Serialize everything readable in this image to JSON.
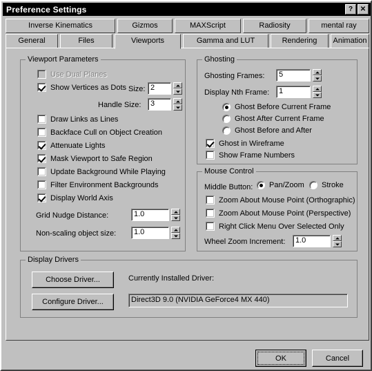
{
  "window": {
    "title": "Preference Settings",
    "help_button": "?",
    "close_button": "✕"
  },
  "tabs": {
    "row1": [
      {
        "label": "Inverse Kinematics",
        "selected": false
      },
      {
        "label": "Gizmos",
        "selected": false
      },
      {
        "label": "MAXScript",
        "selected": false
      },
      {
        "label": "Radiosity",
        "selected": false
      },
      {
        "label": "mental ray",
        "selected": false
      }
    ],
    "row2": [
      {
        "label": "General",
        "selected": false
      },
      {
        "label": "Files",
        "selected": false
      },
      {
        "label": "Viewports",
        "selected": true
      },
      {
        "label": "Gamma and LUT",
        "selected": false
      },
      {
        "label": "Rendering",
        "selected": false
      },
      {
        "label": "Animation",
        "selected": false
      }
    ]
  },
  "viewport_parameters": {
    "title": "Viewport Parameters",
    "use_dual_planes": {
      "label": "Use Dual Planes",
      "checked": false,
      "disabled": true
    },
    "show_vertices_as_dots": {
      "label": "Show Vertices as Dots",
      "checked": true
    },
    "size": {
      "label": "Size:",
      "value": "2"
    },
    "handle_size": {
      "label": "Handle Size:",
      "value": "3"
    },
    "draw_links_as_lines": {
      "label": "Draw Links as Lines",
      "checked": false
    },
    "backface_cull": {
      "label": "Backface Cull on Object Creation",
      "checked": false
    },
    "attenuate_lights": {
      "label": "Attenuate Lights",
      "checked": true
    },
    "mask_viewport_safe_region": {
      "label": "Mask Viewport to Safe Region",
      "checked": true
    },
    "update_background": {
      "label": "Update Background While Playing",
      "checked": false
    },
    "filter_env_backgrounds": {
      "label": "Filter Environment Backgrounds",
      "checked": false
    },
    "display_world_axis": {
      "label": "Display World Axis",
      "checked": true
    },
    "grid_nudge_distance": {
      "label": "Grid Nudge Distance:",
      "value": "1.0"
    },
    "non_scaling_object_size": {
      "label": "Non-scaling object size:",
      "value": "1.0"
    }
  },
  "ghosting": {
    "title": "Ghosting",
    "ghosting_frames": {
      "label": "Ghosting Frames:",
      "value": "5"
    },
    "display_nth_frame": {
      "label": "Display Nth Frame:",
      "value": "1"
    },
    "mode_options": [
      {
        "label": "Ghost Before Current Frame",
        "selected": true
      },
      {
        "label": "Ghost After Current Frame",
        "selected": false
      },
      {
        "label": "Ghost Before and After",
        "selected": false
      }
    ],
    "ghost_in_wireframe": {
      "label": "Ghost in Wireframe",
      "checked": true
    },
    "show_frame_numbers": {
      "label": "Show Frame Numbers",
      "checked": false
    }
  },
  "mouse_control": {
    "title": "Mouse Control",
    "middle_button_label": "Middle Button:",
    "middle_button_options": [
      {
        "label": "Pan/Zoom",
        "selected": true
      },
      {
        "label": "Stroke",
        "selected": false
      }
    ],
    "zoom_about_mouse_ortho": {
      "label": "Zoom About Mouse Point (Orthographic)",
      "checked": false
    },
    "zoom_about_mouse_persp": {
      "label": "Zoom About Mouse Point (Perspective)",
      "checked": false
    },
    "right_click_menu": {
      "label": "Right Click Menu Over Selected Only",
      "checked": false
    },
    "wheel_zoom_increment": {
      "label": "Wheel Zoom Increment:",
      "value": "1.0"
    }
  },
  "display_drivers": {
    "title": "Display Drivers",
    "choose_driver_button": "Choose Driver...",
    "configure_driver_button": "Configure Driver...",
    "currently_installed_label": "Currently Installed Driver:",
    "driver_name": "Direct3D 9.0 (NVIDIA GeForce4 MX 440)"
  },
  "footer": {
    "ok_button": "OK",
    "cancel_button": "Cancel"
  },
  "colors": {
    "face": "#c0c0c0",
    "titlebar": "#000000",
    "titlebar_text": "#ffffff",
    "group_border": "#808080",
    "disabled_text": "#808080"
  }
}
